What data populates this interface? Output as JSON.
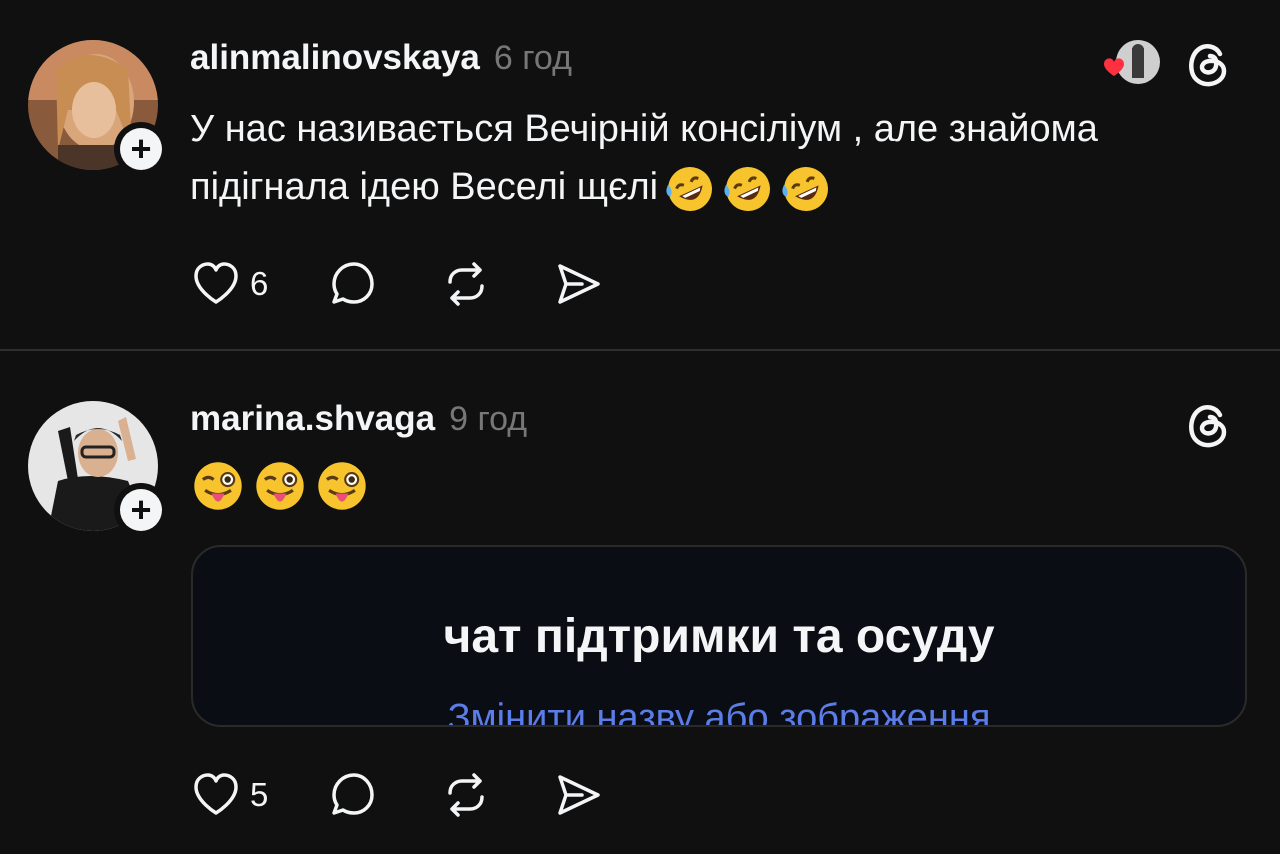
{
  "posts": [
    {
      "username": "alinmalinovskaya",
      "time": "6 год",
      "text": "У нас називається Вечірній консіліум , але знайома підігнала ідею Веселі щєлі",
      "emojis": [
        "rofl-emoji",
        "rofl-emoji",
        "rofl-emoji"
      ],
      "likes": "6",
      "liked_by_icon": "heart-avatar-icon"
    },
    {
      "username": "marina.shvaga",
      "time": "9 год",
      "emojis": [
        "winking-tongue-emoji",
        "winking-tongue-emoji",
        "winking-tongue-emoji"
      ],
      "embed": {
        "title": "чат підтримки та осуду",
        "link": "Змінити назву або зображення"
      },
      "likes": "5"
    }
  ],
  "colors": {
    "background": "#101010",
    "text": "#f3f5f7",
    "muted": "#777777",
    "link": "#5b7de8",
    "heart": "#ff3040"
  },
  "icons": [
    "plus-icon",
    "threads-icon",
    "heart-icon",
    "comment-icon",
    "repost-icon",
    "share-icon"
  ]
}
